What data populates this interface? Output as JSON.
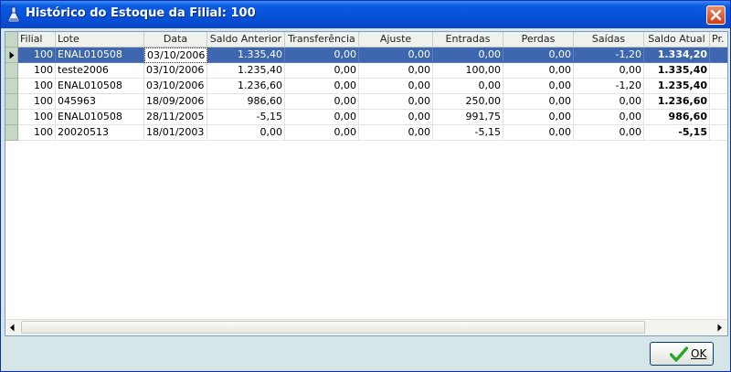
{
  "window": {
    "title": "Histórico do Estoque da Filial: 100",
    "icons": {
      "title": "flask-icon",
      "close": "close-icon"
    }
  },
  "grid": {
    "columns": [
      "Filial",
      "Lote",
      "Data",
      "Saldo Anterior",
      "Transferência",
      "Ajuste",
      "Entradas",
      "Perdas",
      "Saídas",
      "Saldo Atual",
      "Pr."
    ],
    "rows": [
      [
        "100",
        "ENAL010508",
        "03/10/2006",
        "1.335,40",
        "0,00",
        "0,00",
        "0,00",
        "0,00",
        "-1,20",
        "1.334,20",
        ""
      ],
      [
        "100",
        "teste2006",
        "03/10/2006",
        "1.235,40",
        "0,00",
        "0,00",
        "100,00",
        "0,00",
        "0,00",
        "1.335,40",
        ""
      ],
      [
        "100",
        "ENAL010508",
        "03/10/2006",
        "1.236,60",
        "0,00",
        "0,00",
        "0,00",
        "0,00",
        "-1,20",
        "1.235,40",
        ""
      ],
      [
        "100",
        "045963",
        "18/09/2006",
        "986,60",
        "0,00",
        "0,00",
        "250,00",
        "0,00",
        "0,00",
        "1.236,60",
        ""
      ],
      [
        "100",
        "ENAL010508",
        "28/11/2005",
        "-5,15",
        "0,00",
        "0,00",
        "991,75",
        "0,00",
        "0,00",
        "986,60",
        ""
      ],
      [
        "100",
        "20020513",
        "18/01/2003",
        "0,00",
        "0,00",
        "0,00",
        "-5,15",
        "0,00",
        "0,00",
        "-5,15",
        ""
      ]
    ],
    "selected_row": 0,
    "icons": {
      "row_indicator": "row-pointer-icon",
      "scroll_left": "arrow-left-icon",
      "scroll_right": "arrow-right-icon"
    }
  },
  "footer": {
    "ok_label": "OK",
    "ok_icon": "checkmark-icon"
  },
  "colors": {
    "title_bar": "#0551d8",
    "selection": "#3f67b0",
    "ok_check": "#2aa52a"
  }
}
